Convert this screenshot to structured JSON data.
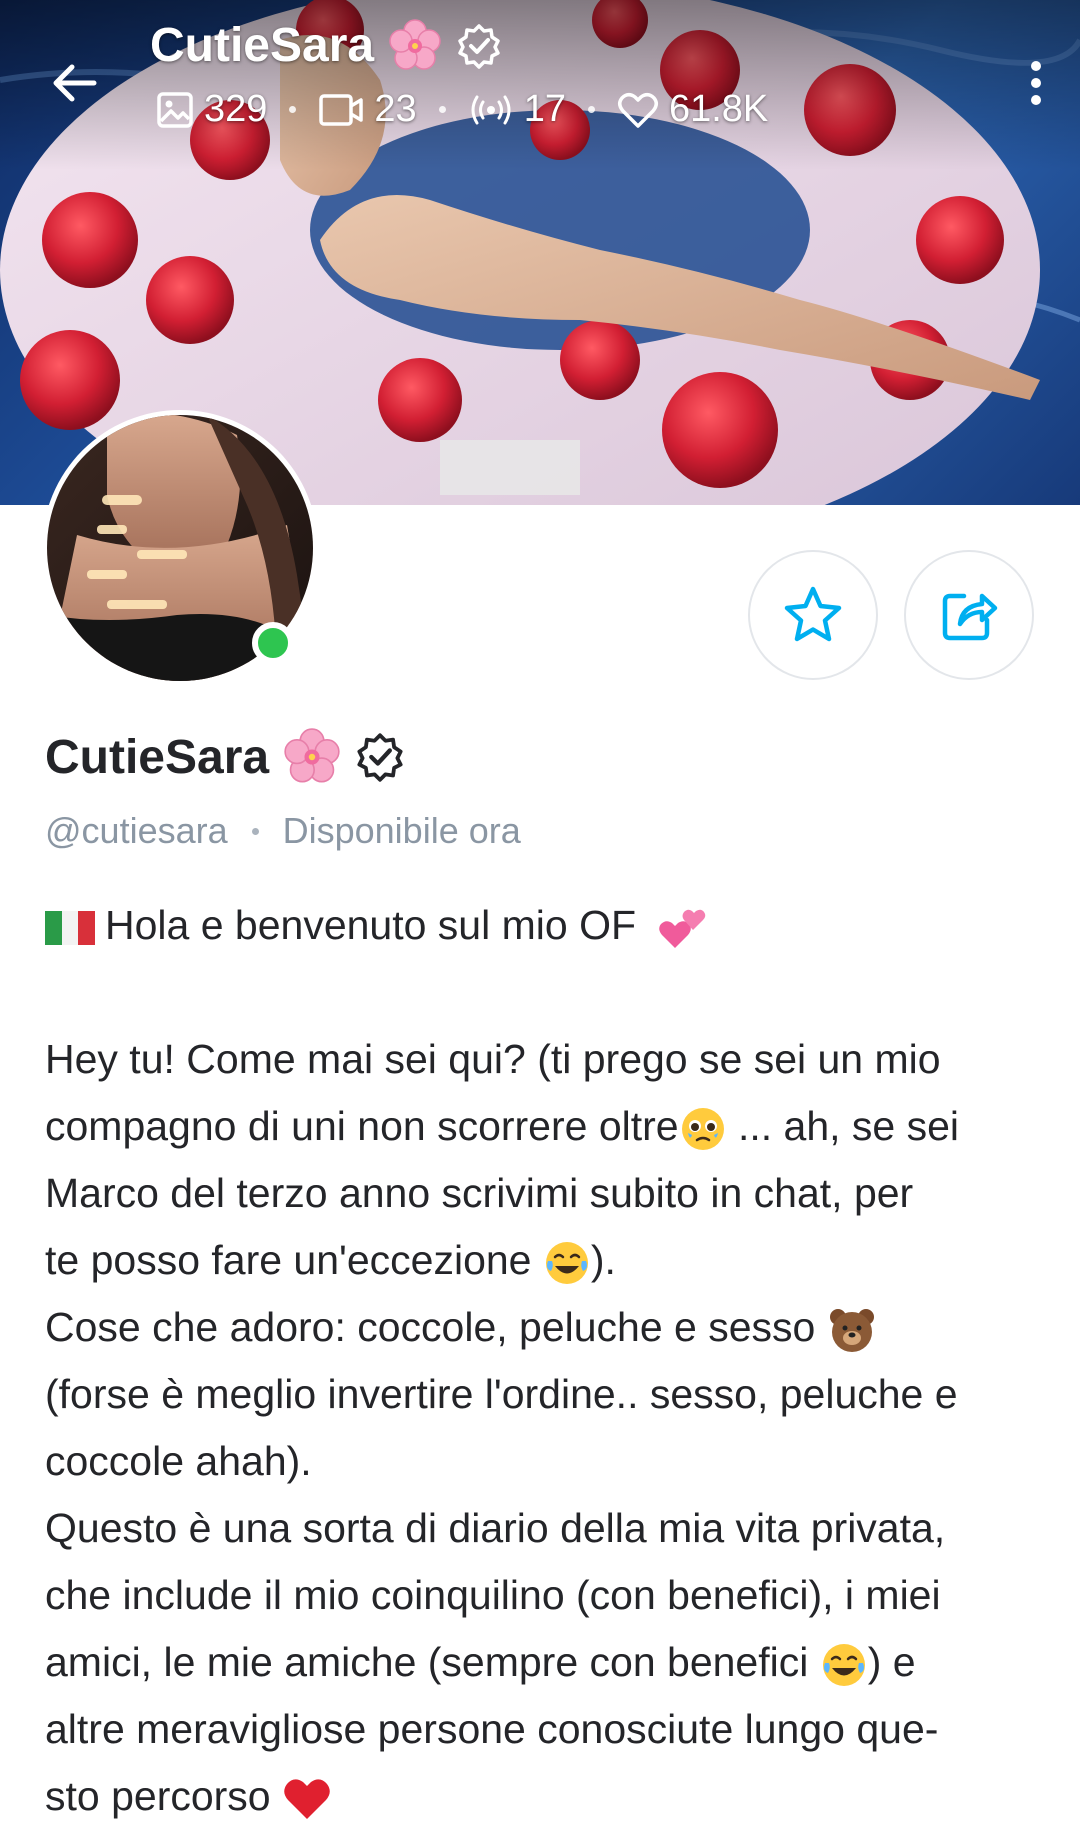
{
  "header": {
    "name": "CutieSara",
    "name_emoji_icon": "cherry-blossom-icon",
    "verified_icon": "verified-badge-icon",
    "stats": {
      "photos": "329",
      "videos": "23",
      "streams": "17",
      "likes": "61.8K"
    }
  },
  "profile": {
    "name": "CutieSara",
    "handle": "@cutiesara",
    "status": "Disponibile ora",
    "online": true
  },
  "actions": {
    "favorite_icon": "star-icon",
    "share_icon": "share-icon"
  },
  "bio": {
    "intro": "Hola e benvenuto sul mio OF",
    "line1": "Hey tu! Come mai sei qui? (ti prego se sei un mio",
    "line2a": "compagno di uni non scorrere oltre",
    "line2b": " ... ah, se sei",
    "line3": "Marco del terzo anno scrivimi subito in chat, per",
    "line4a": "te posso fare un'eccezione ",
    "line4b": ").",
    "line5a": "Cose che adoro: coccole, peluche e sesso ",
    "line6": "(forse è meglio invertire l'ordine.. sesso, peluche e",
    "line7": "coccole ahah).",
    "line8": "Questo è una sorta di diario della mia vita privata,",
    "line9": "che include il mio coinquilino (con benefici), i miei",
    "line10a": "amici, le mie amiche (sempre con benefici ",
    "line10b": ") e",
    "line11": "altre meravigliose persone conosciute lungo que-",
    "line12a": "sto percorso "
  },
  "colors": {
    "accent": "#00aff0",
    "online": "#2ec550",
    "muted": "#8a96a3",
    "text": "#242529"
  }
}
